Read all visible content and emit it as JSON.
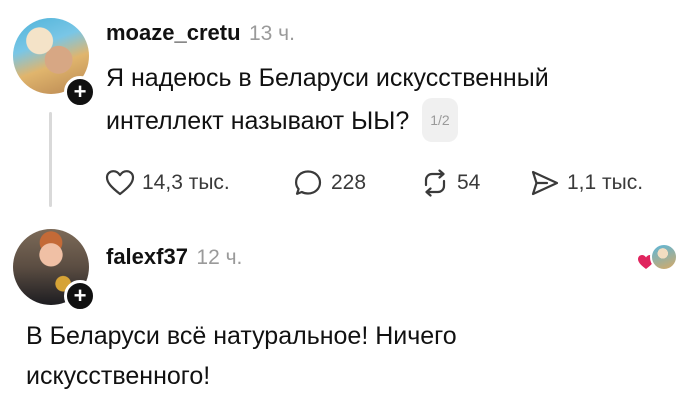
{
  "post": {
    "username": "moaze_cretu",
    "time": "13 ч.",
    "text_line1": "Я надеюсь в Беларуси искусственный",
    "text_line2": "интеллект называют ЫЫ?",
    "pager": "1/2",
    "actions": {
      "likes": "14,3 тыс.",
      "comments": "228",
      "reposts": "54",
      "shares": "1,1 тыс."
    },
    "icons": {
      "like": "heart-icon",
      "comment": "comment-icon",
      "repost": "repost-icon",
      "share": "share-icon",
      "follow": "plus-icon"
    }
  },
  "reply": {
    "username": "falexf37",
    "time": "12 ч.",
    "text_line1": "В Беларуси всё натуральное! Ничего",
    "text_line2": "искусственного!",
    "icons": {
      "liked_by_author": "heart-filled-icon",
      "follow": "plus-icon"
    }
  },
  "colors": {
    "text": "#111111",
    "muted": "#9a9a9a",
    "heart": "#e0245e"
  }
}
